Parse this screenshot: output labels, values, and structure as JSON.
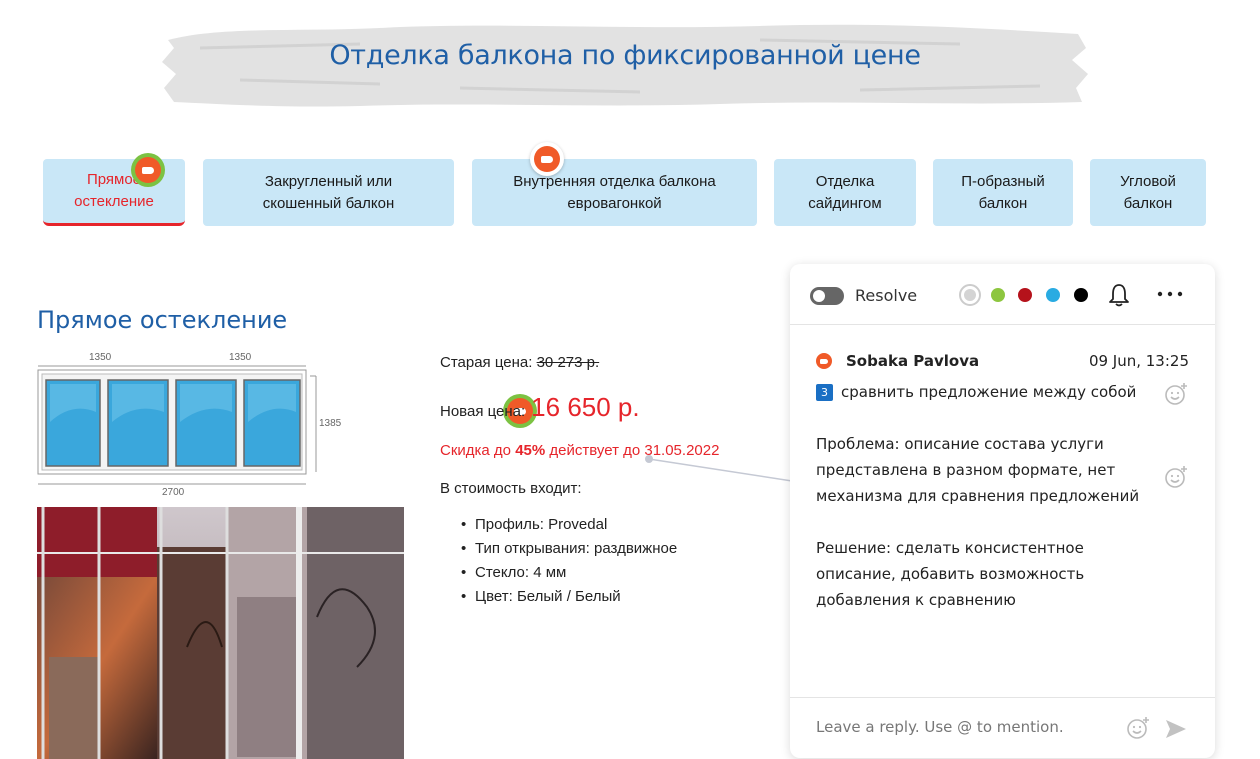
{
  "banner": {
    "title": "Отделка балкона по фиксированной цене"
  },
  "tabs": [
    {
      "label": "Прямое\nостекление",
      "active": true
    },
    {
      "label": "Закругленный или\nскошенный балкон"
    },
    {
      "label": "Внутренняя отделка балкона\nевровагонкой"
    },
    {
      "label": "Отделка\nсайдингом"
    },
    {
      "label": "П-образный\nбалкон"
    },
    {
      "label": "Угловой\nбалкон"
    }
  ],
  "section": {
    "title": "Прямое остекление",
    "diagram": {
      "w1": "1350",
      "w2": "1350",
      "height": "1385",
      "total": "2700"
    },
    "old_price_label": "Старая цена:",
    "old_price": "30 273 р.",
    "new_price_label": "Новая цена:",
    "new_price": "16 650 р.",
    "discount_prefix": "Скидка до",
    "discount_value": "45%",
    "discount_suffix": "действует до 31.05.2022",
    "includes_label": "В стоимость входит:",
    "features": [
      "Профиль: Provedal",
      "Тип открывания: раздвижное",
      "Стекло: 4 мм",
      "Цвет: Белый / Белый"
    ]
  },
  "comment_panel": {
    "resolve_label": "Resolve",
    "colors": [
      "#d4d4d4",
      "#8dc63f",
      "#b5121b",
      "#29abe2",
      "#000000"
    ],
    "author": "Sobaka Pavlova",
    "timestamp": "09 Jun, 13:25",
    "badge": "3",
    "paragraphs": [
      "сравнить предложение между собой",
      "Проблема: описание состава услуги представлена в разном формате, нет механизма для сравнения предложений",
      "Решение: сделать консистентное описание, добавить возможность добавления к сравнению"
    ],
    "reply_placeholder": "Leave a reply. Use @ to mention."
  },
  "icons": {
    "marker": "comment-marker-icon",
    "bell": "bell-icon",
    "more": "more-icon",
    "emoji": "add-reaction-icon",
    "send": "send-icon"
  }
}
